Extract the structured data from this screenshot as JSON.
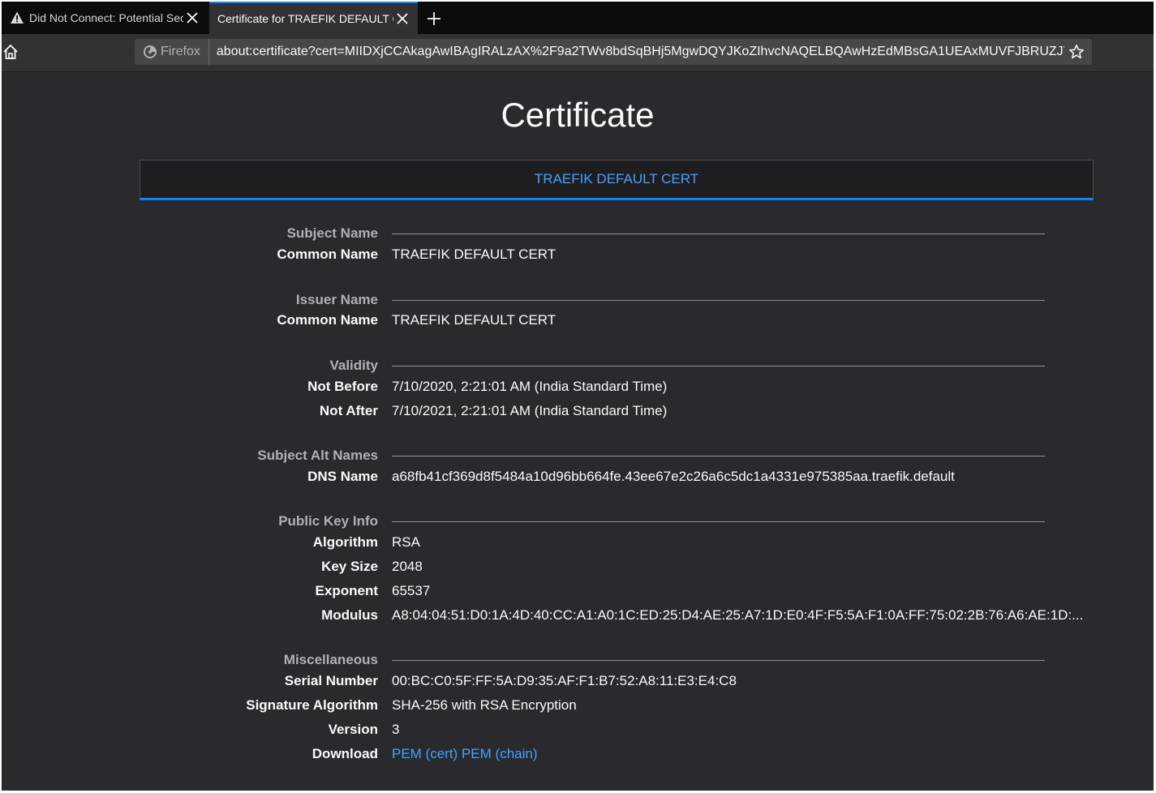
{
  "browser": {
    "tabs": [
      {
        "title": "Did Not Connect: Potential Security Issue",
        "active": false
      },
      {
        "title": "Certificate for TRAEFIK DEFAULT CERT",
        "active": true
      }
    ],
    "identity_label": "Firefox",
    "url": "about:certificate?cert=MIIDXjCCAkagAwIBAgIRALzAX%2F9a2TWv8bdSqBHj5MgwDQYJKoZIhvcNAQELBQAwHzEdMBsGA1UEAxMUVFJBRUZJTiBERUZBVUxUIENFUlQ"
  },
  "page": {
    "title": "Certificate",
    "cert_tab": "TRAEFIK DEFAULT CERT"
  },
  "sections": {
    "subject": {
      "label": "Subject Name",
      "common_name_label": "Common Name",
      "common_name": "TRAEFIK DEFAULT CERT"
    },
    "issuer": {
      "label": "Issuer Name",
      "common_name_label": "Common Name",
      "common_name": "TRAEFIK DEFAULT CERT"
    },
    "validity": {
      "label": "Validity",
      "not_before_label": "Not Before",
      "not_before": "7/10/2020, 2:21:01 AM (India Standard Time)",
      "not_after_label": "Not After",
      "not_after": "7/10/2021, 2:21:01 AM (India Standard Time)"
    },
    "san": {
      "label": "Subject Alt Names",
      "dns_label": "DNS Name",
      "dns": "a68fb41cf369d8f5484a10d96bb664fe.43ee67e2c26a6c5dc1a4331e975385aa.traefik.default"
    },
    "public_key": {
      "label": "Public Key Info",
      "algorithm_label": "Algorithm",
      "algorithm": "RSA",
      "key_size_label": "Key Size",
      "key_size": "2048",
      "exponent_label": "Exponent",
      "exponent": "65537",
      "modulus_label": "Modulus",
      "modulus": "A8:04:04:51:D0:1A:4D:40:CC:A1:A0:1C:ED:25:D4:AE:25:A7:1D:E0:4F:F5:5A:F1:0A:FF:75:02:2B:76:A6:AE:1D:..."
    },
    "misc": {
      "label": "Miscellaneous",
      "serial_label": "Serial Number",
      "serial": "00:BC:C0:5F:FF:5A:D9:35:AF:F1:B7:52:A8:11:E3:E4:C8",
      "sig_alg_label": "Signature Algorithm",
      "sig_alg": "SHA-256 with RSA Encryption",
      "version_label": "Version",
      "version": "3",
      "download_label": "Download",
      "pem_cert": "PEM (cert)",
      "pem_chain": "PEM (chain)"
    }
  },
  "colors": {
    "background": "#2a2a2e",
    "accent": "#0a84ff",
    "link": "#45a1ff"
  }
}
